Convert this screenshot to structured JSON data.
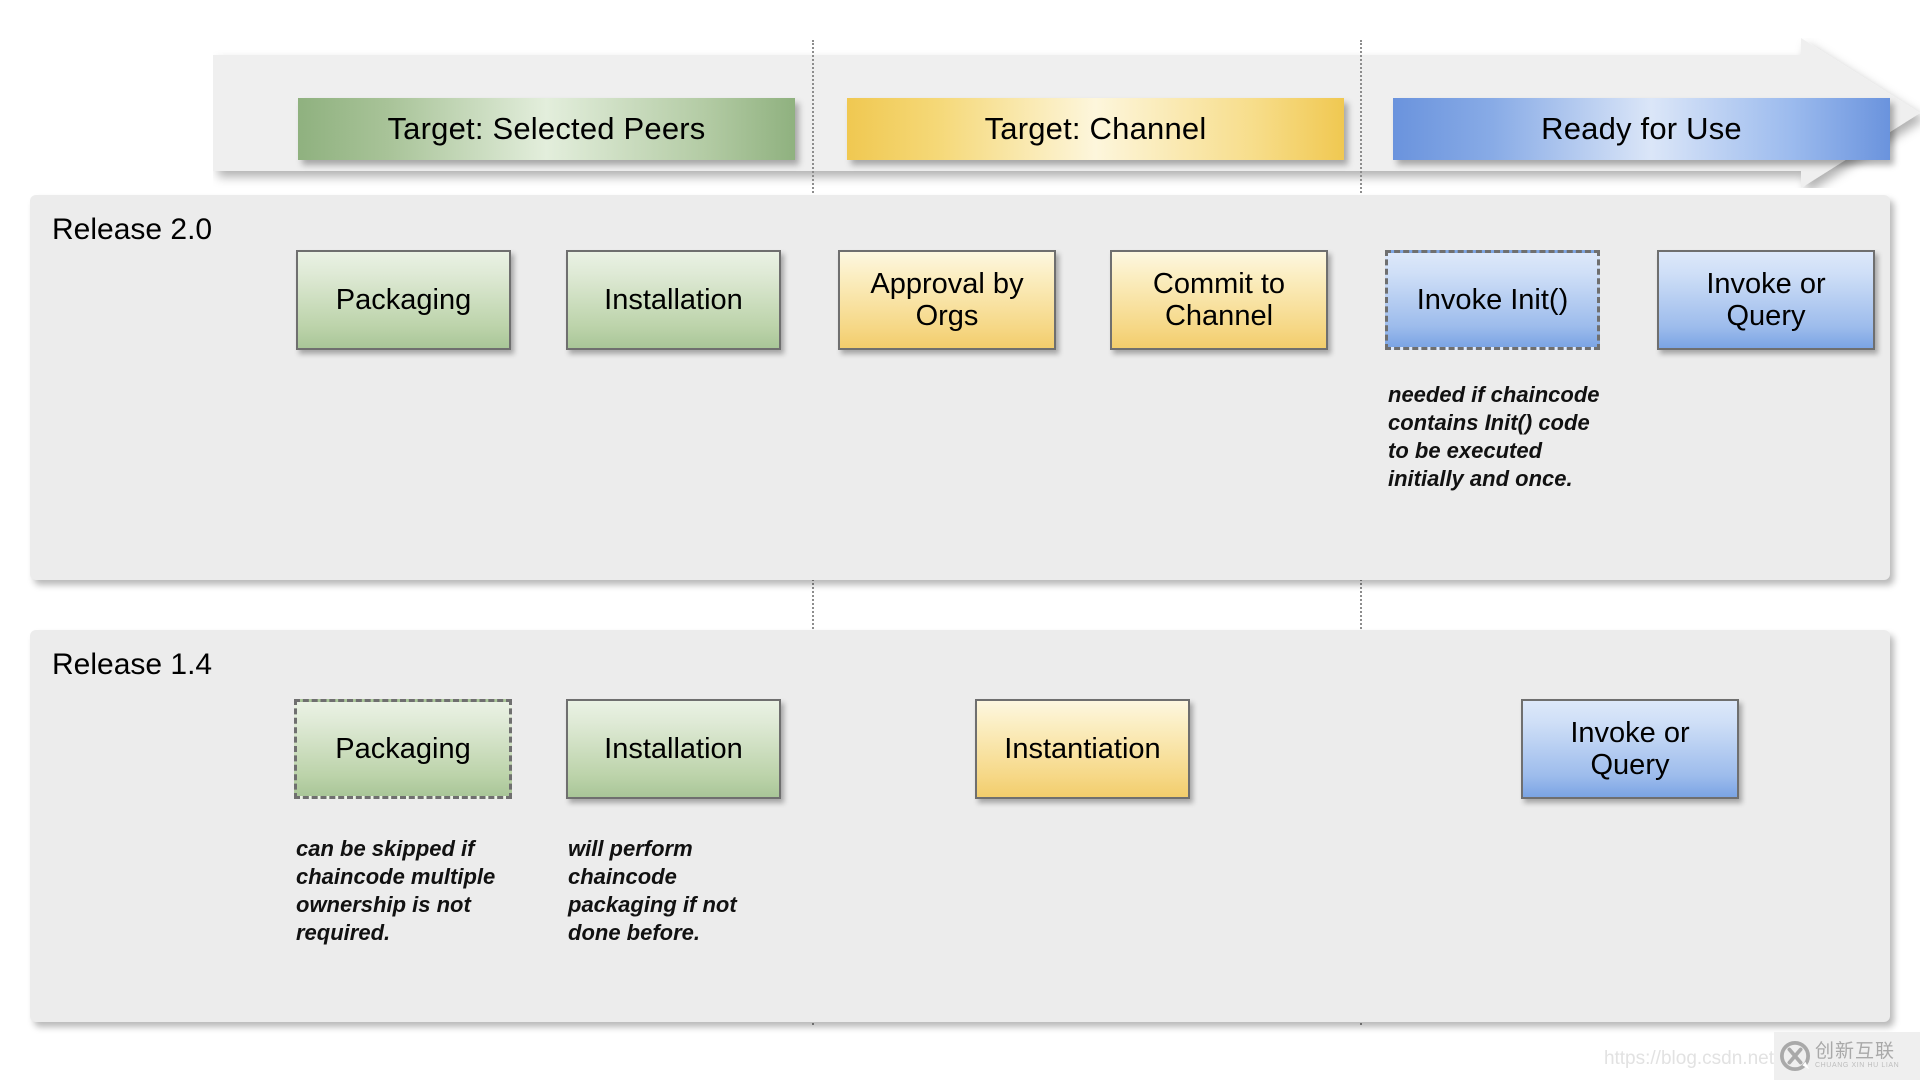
{
  "arrow": {
    "banners": [
      {
        "id": "peers",
        "label": "Target: Selected Peers",
        "color": "#a8c398"
      },
      {
        "id": "channel",
        "label": "Target: Channel",
        "color": "#f5d877"
      },
      {
        "id": "ready",
        "label": "Ready for Use",
        "color": "#88abe6"
      }
    ]
  },
  "rows": [
    {
      "id": "release20",
      "label": "Release 2.0",
      "boxes": [
        {
          "id": "packaging",
          "label": "Packaging",
          "fill": "green",
          "style": "solid"
        },
        {
          "id": "installation",
          "label": "Installation",
          "fill": "green",
          "style": "solid"
        },
        {
          "id": "approval",
          "label": "Approval by Orgs",
          "fill": "yellow",
          "style": "solid"
        },
        {
          "id": "commit",
          "label": "Commit to Channel",
          "fill": "yellow",
          "style": "solid"
        },
        {
          "id": "invoke-init",
          "label": "Invoke Init()",
          "fill": "blue",
          "style": "dashed"
        },
        {
          "id": "invoke-query",
          "label": "Invoke or Query",
          "fill": "blue",
          "style": "solid"
        }
      ],
      "captions": [
        {
          "id": "invoke-init-note",
          "text": "needed if chaincode contains Init() code to be executed initially and once."
        }
      ]
    },
    {
      "id": "release14",
      "label": "Release 1.4",
      "boxes": [
        {
          "id": "packaging",
          "label": "Packaging",
          "fill": "green",
          "style": "dashed"
        },
        {
          "id": "installation",
          "label": "Installation",
          "fill": "green",
          "style": "solid"
        },
        {
          "id": "instantiation",
          "label": "Instantiation",
          "fill": "yellow",
          "style": "solid"
        },
        {
          "id": "invoke-query",
          "label": "Invoke or Query",
          "fill": "blue",
          "style": "solid"
        }
      ],
      "captions": [
        {
          "id": "packaging-note",
          "text": "can be skipped if chaincode multiple ownership is not required."
        },
        {
          "id": "installation-note",
          "text": "will perform chaincode packaging if not done before."
        }
      ]
    }
  ],
  "watermark": {
    "url": "https://blog.csdn.net",
    "brand_cn": "创新互联",
    "brand_pinyin": "CHUANG XIN HU LIAN"
  }
}
